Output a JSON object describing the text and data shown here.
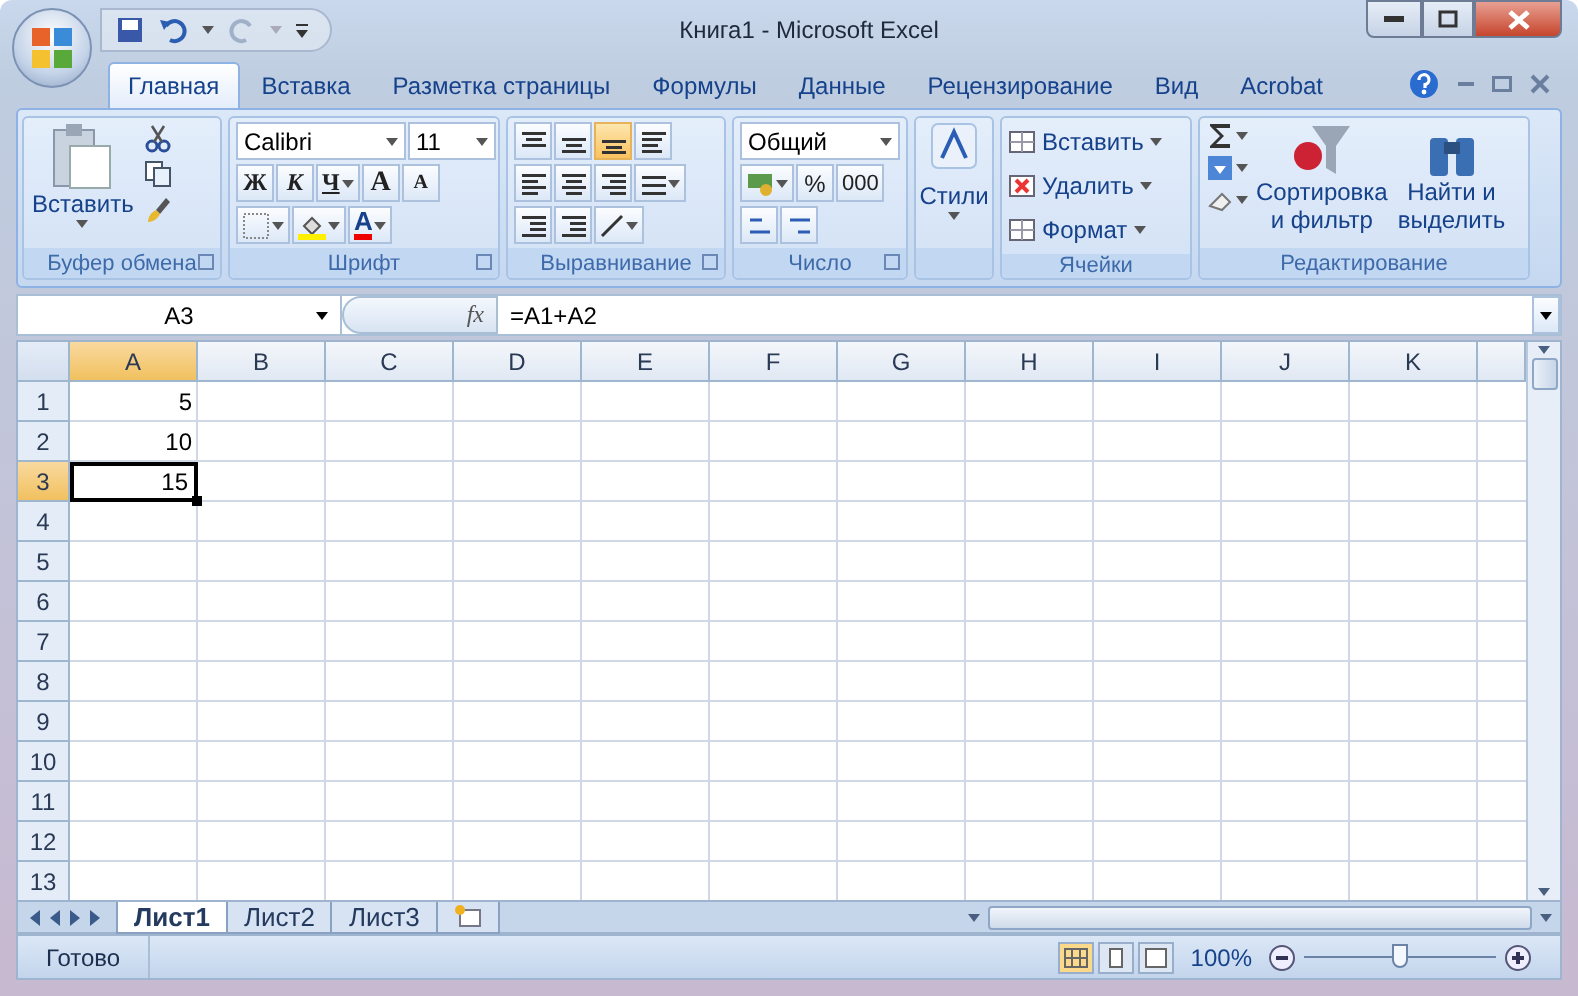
{
  "window": {
    "title": "Книга1 - Microsoft Excel"
  },
  "tabs": [
    {
      "label": "Главная",
      "selected": true
    },
    {
      "label": "Вставка",
      "selected": false
    },
    {
      "label": "Разметка страницы",
      "selected": false
    },
    {
      "label": "Формулы",
      "selected": false
    },
    {
      "label": "Данные",
      "selected": false
    },
    {
      "label": "Рецензирование",
      "selected": false
    },
    {
      "label": "Вид",
      "selected": false
    },
    {
      "label": "Acrobat",
      "selected": false
    }
  ],
  "ribbon": {
    "clipboard": {
      "label": "Буфер обмена",
      "paste": "Вставить"
    },
    "font": {
      "label": "Шрифт",
      "name": "Calibri",
      "size": "11",
      "bold": "Ж",
      "italic": "К",
      "underline": "Ч",
      "grow": "A",
      "shrink": "A",
      "color_letter": "A"
    },
    "alignment": {
      "label": "Выравнивание"
    },
    "number": {
      "label": "Число",
      "format": "Общий",
      "percent": "%",
      "thousands": "000"
    },
    "styles": {
      "label": "Стили"
    },
    "cells": {
      "label": "Ячейки",
      "items": [
        "Вставить",
        "Удалить",
        "Формат"
      ]
    },
    "editing": {
      "label": "Редактирование",
      "sort": [
        "Сортировка",
        "и фильтр"
      ],
      "find": [
        "Найти и",
        "выделить"
      ]
    }
  },
  "formula_bar": {
    "name_box": "A3",
    "fx": "fx",
    "formula": "=A1+A2"
  },
  "sheet": {
    "columns": [
      {
        "label": "A",
        "selected": true
      },
      {
        "label": "B",
        "selected": false
      },
      {
        "label": "C",
        "selected": false
      },
      {
        "label": "D",
        "selected": false
      },
      {
        "label": "E",
        "selected": false
      },
      {
        "label": "F",
        "selected": false
      },
      {
        "label": "G",
        "selected": false
      },
      {
        "label": "H",
        "selected": false
      },
      {
        "label": "I",
        "selected": false
      },
      {
        "label": "J",
        "selected": false
      },
      {
        "label": "K",
        "selected": false
      }
    ],
    "rows": [
      {
        "header": "1",
        "value": "5",
        "selected": false
      },
      {
        "header": "2",
        "value": "10",
        "selected": false
      },
      {
        "header": "3",
        "value": "15",
        "selected": true
      },
      {
        "header": "4",
        "selected": false
      },
      {
        "header": "5",
        "selected": false
      },
      {
        "header": "6",
        "selected": false
      },
      {
        "header": "7",
        "selected": false
      },
      {
        "header": "8",
        "selected": false
      },
      {
        "header": "9",
        "selected": false
      },
      {
        "header": "10",
        "selected": false
      },
      {
        "header": "11",
        "selected": false
      },
      {
        "header": "12",
        "selected": false
      },
      {
        "header": "13",
        "selected": false
      }
    ]
  },
  "sheet_tabs": [
    {
      "label": "Лист1",
      "selected": true
    },
    {
      "label": "Лист2",
      "selected": false
    },
    {
      "label": "Лист3",
      "selected": false
    }
  ],
  "status_bar": {
    "status": "Готово",
    "zoom": "100%",
    "zoom_slider": {
      "level": 0.5
    }
  }
}
